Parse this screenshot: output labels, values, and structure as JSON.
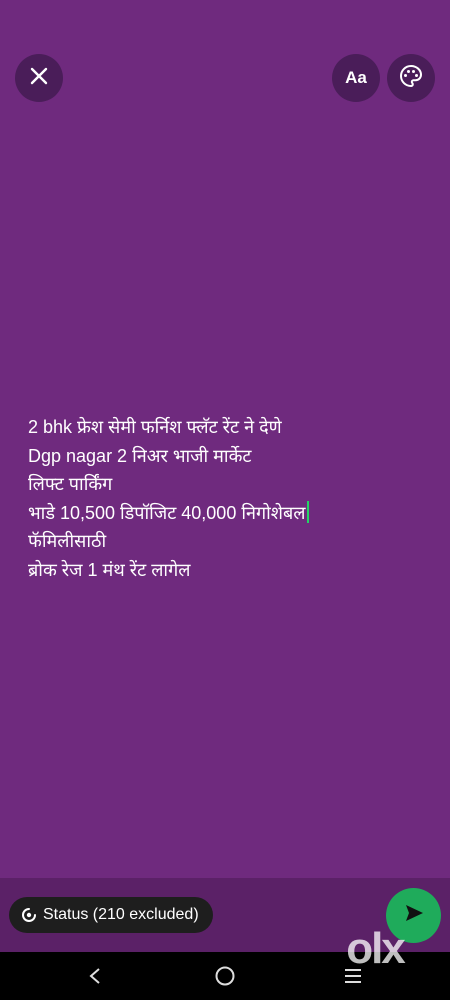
{
  "toolbar": {
    "close_icon": "close-icon",
    "font_label": "Aa",
    "palette_icon": "palette-icon"
  },
  "status": {
    "lines": [
      "2 bhk फ्रेश सेमी फर्निश फ्लॅट रेंट ने देणे",
      "Dgp nagar 2 निअर भाजी मार्केट",
      "लिफ्ट पार्किंग",
      "भाडे 10,500 डिपॉजिट 40,000 निगोशेबल",
      "फॅमिलीसाठी",
      "ब्रोक रेज 1 मंथ रेंट लागेल"
    ]
  },
  "bottom": {
    "audience_label": "Status (210 excluded)",
    "send_icon": "send-icon"
  },
  "watermark": {
    "text": "olx"
  },
  "colors": {
    "background": "#6f2a7e",
    "cursor": "#25d366",
    "send_button": "#1fab5b"
  }
}
